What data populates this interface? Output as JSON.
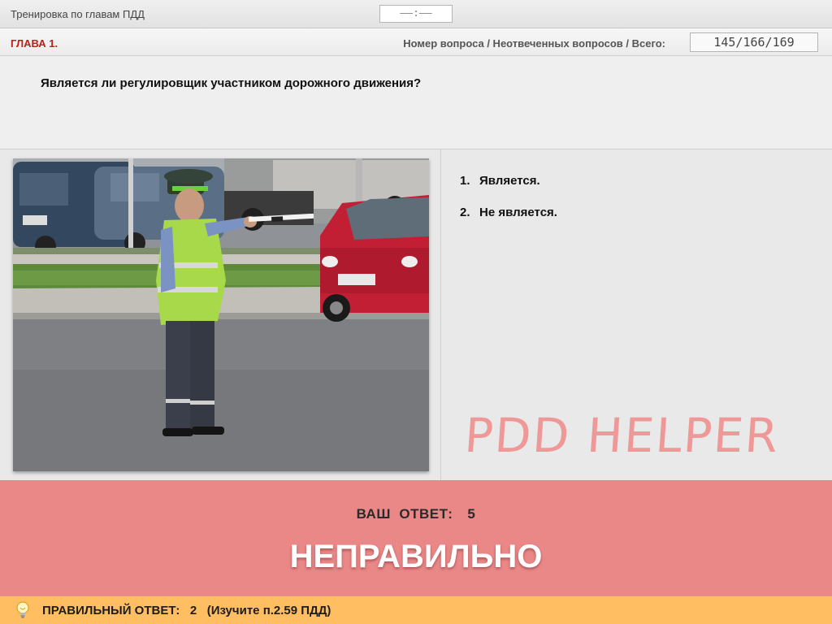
{
  "header": {
    "title": "Тренировка по главам ПДД",
    "timer": "——:——"
  },
  "chapter_bar": {
    "chapter": "ГЛАВА 1.",
    "counter_label": "Номер вопроса / Неотвеченных вопросов / Всего:",
    "counter_value": "145/166/169"
  },
  "question": {
    "text": "Является ли регулировщик участником дорожного движения?"
  },
  "answers": [
    {
      "num": "1.",
      "label": "Является."
    },
    {
      "num": "2.",
      "label": "Не является."
    }
  ],
  "watermark": "PDD HELPER",
  "result": {
    "your_answer_label": "ВАШ  ОТВЕТ:",
    "your_answer_value": "5",
    "verdict": "НЕПРАВИЛЬНО"
  },
  "correct": {
    "label": "ПРАВИЛЬНЫЙ ОТВЕТ:",
    "value": "2",
    "hint": "(Изучите п.2.59 ПДД)"
  },
  "icons": {
    "hint": "lightbulb-icon"
  },
  "colors": {
    "chapter_accent": "#b8201a",
    "result_bg": "#ea8888",
    "correct_bg": "#ffbe61",
    "watermark": "#ef8a8a"
  }
}
